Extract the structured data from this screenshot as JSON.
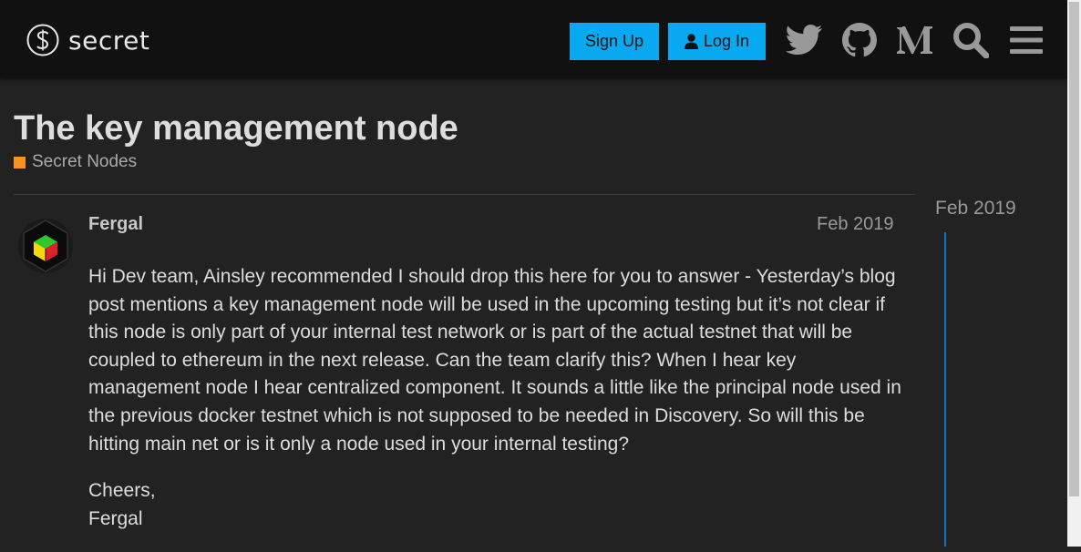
{
  "header": {
    "brand": "secret",
    "signup_label": "Sign Up",
    "login_label": "Log In",
    "icons": [
      "twitter-icon",
      "github-icon",
      "medium-icon",
      "search-icon",
      "menu-icon"
    ]
  },
  "topic": {
    "title": "The key management node",
    "category": "Secret Nodes",
    "category_color": "#f7941d"
  },
  "post": {
    "username": "Fergal",
    "date": "Feb 2019",
    "paragraphs": [
      "Hi Dev team, Ainsley recommended I should drop this here for you to answer - Yesterday’s blog post mentions a key management node will be used in the upcoming testing but it’s not clear if this node is only part of your internal test network or is part of the actual testnet that will be coupled to ethereum in the next release. Can the team clarify this? When I hear key management node I hear centralized component. It sounds a little like the principal node used in the previous docker testnet which is not supposed to be needed in Discovery. So will this be hitting main net or is it only a node used in your internal testing?"
    ],
    "signoff_line1": "Cheers,",
    "signoff_line2": "Fergal"
  },
  "timeline": {
    "date": "Feb 2019"
  },
  "colors": {
    "accent": "#08a9f0",
    "background": "#222222",
    "header_bg": "#111111",
    "timeline": "#0e76bd"
  }
}
